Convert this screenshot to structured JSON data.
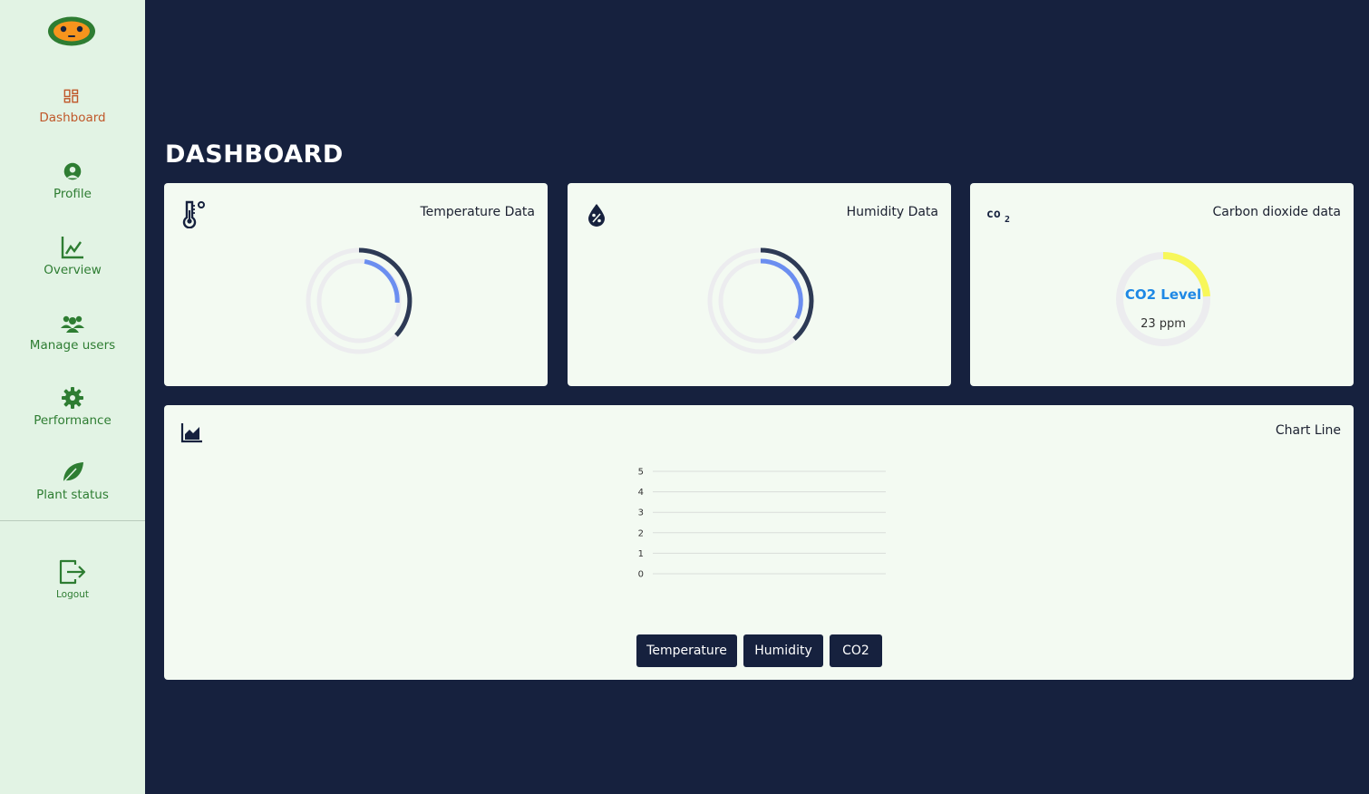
{
  "sidebar": {
    "items": [
      {
        "label": "Dashboard",
        "icon": "dashboard-grid-icon",
        "active": true
      },
      {
        "label": "Profile",
        "icon": "profile-icon"
      },
      {
        "label": "Overview",
        "icon": "chart-line-icon"
      },
      {
        "label": "Manage users",
        "icon": "users-icon"
      },
      {
        "label": "Performance",
        "icon": "gear-icon"
      },
      {
        "label": "Plant status",
        "icon": "leaf-icon"
      }
    ],
    "logout_label": "Logout"
  },
  "page_title": "DASHBOARD",
  "cards": {
    "temperature": {
      "title": "Temperature Data",
      "icon": "thermometer-icon"
    },
    "humidity": {
      "title": "Humidity Data",
      "icon": "humidity-drop-icon"
    },
    "co2": {
      "title": "Carbon dioxide data",
      "icon": "co2-icon",
      "gauge_title": "CO2 Level",
      "gauge_value": "23 ppm"
    }
  },
  "line_chart": {
    "title": "Chart Line",
    "icon": "area-chart-icon",
    "buttons": [
      "Temperature",
      "Humidity",
      "CO2"
    ]
  },
  "chart_data": {
    "type": "line",
    "title": "",
    "xlabel": "",
    "ylabel": "",
    "ylim": [
      0,
      5
    ],
    "yticks": [
      "0",
      "1",
      "2",
      "3",
      "4",
      "5"
    ],
    "series": [],
    "grid": true
  },
  "colors": {
    "background": "#16213e",
    "sidebar": "#e2f3e4",
    "card": "#f3faf2",
    "accent_active": "#c0582a",
    "nav_text": "#2e7d32",
    "gauge_dark": "#2d3a55",
    "gauge_blue": "#6b8ef0",
    "gauge_yellow": "#f7f75a",
    "co2_label": "#1e88e5"
  }
}
